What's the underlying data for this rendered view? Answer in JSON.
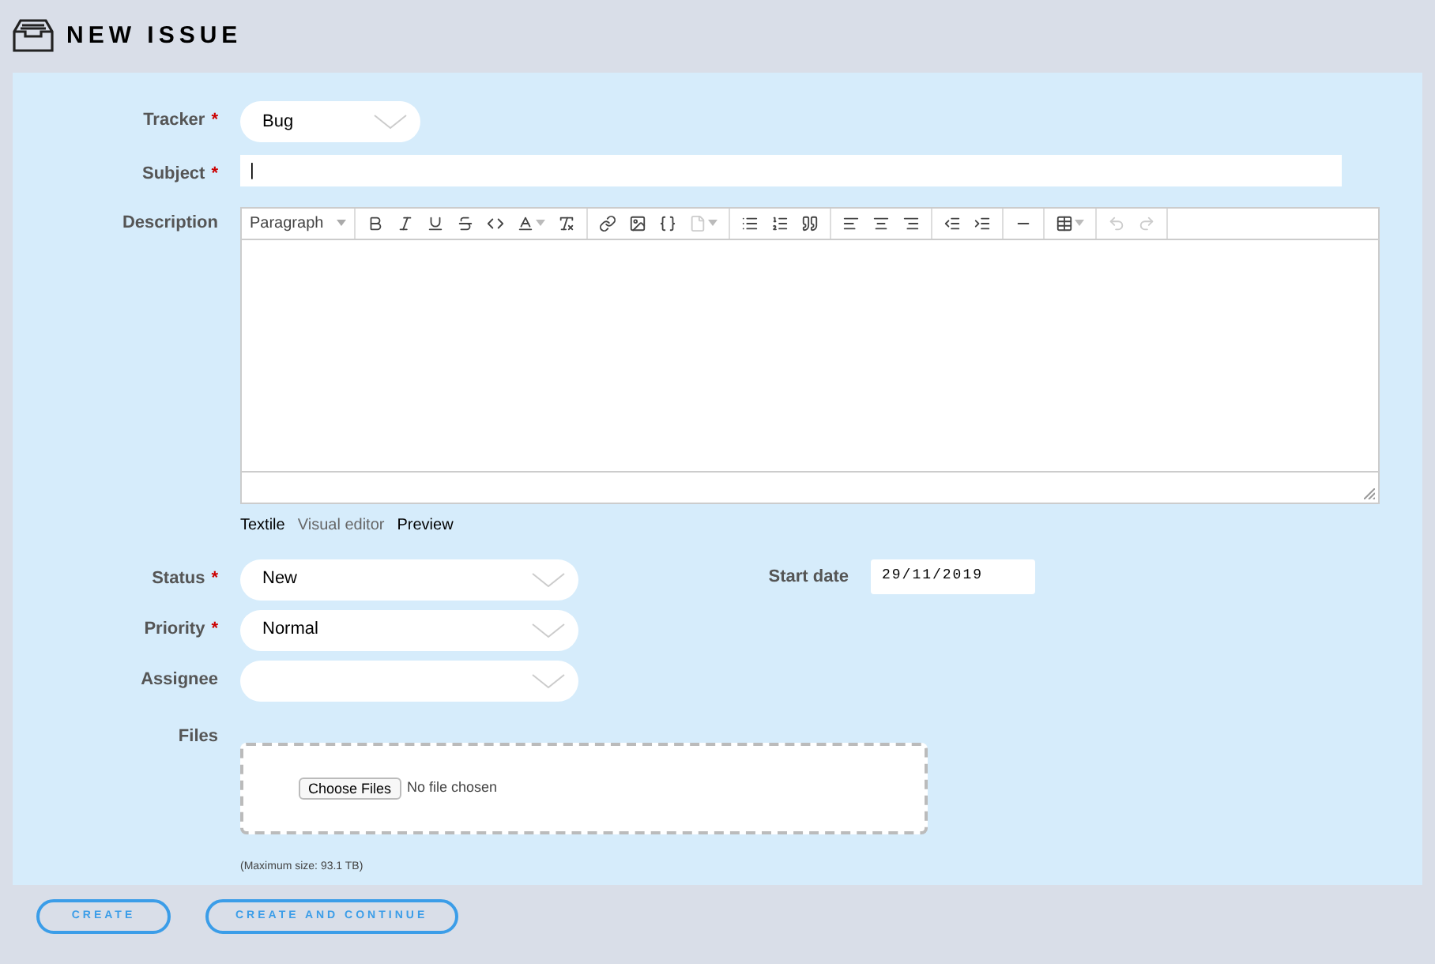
{
  "header": {
    "title": "NEW ISSUE"
  },
  "fields": [
    {
      "kind": "select",
      "label": "Tracker",
      "required_mark": "*",
      "value": "Bug"
    },
    {
      "kind": "text",
      "label": "Subject",
      "required_mark": "*",
      "value": "|"
    }
  ],
  "description": {
    "label": "Description",
    "paragraph": "Paragraph",
    "toolbar": [
      [
        {
          "kind": "bold",
          "disabled": false
        },
        {
          "kind": "italic",
          "disabled": false
        },
        {
          "kind": "underline",
          "disabled": false
        },
        {
          "kind": "strike",
          "disabled": false
        },
        {
          "kind": "code",
          "disabled": false
        },
        {
          "kind": "color",
          "disabled": false
        },
        {
          "kind": "clear",
          "disabled": false
        }
      ],
      [
        {
          "kind": "link",
          "disabled": false
        },
        {
          "kind": "image",
          "disabled": false
        },
        {
          "kind": "codeblock",
          "disabled": false
        },
        {
          "kind": "file",
          "disabled": true
        }
      ],
      [
        {
          "kind": "bullets",
          "disabled": false
        },
        {
          "kind": "numbers",
          "disabled": false
        },
        {
          "kind": "quote",
          "disabled": false
        }
      ],
      [
        {
          "kind": "left",
          "disabled": false
        },
        {
          "kind": "center",
          "disabled": false
        },
        {
          "kind": "right",
          "disabled": false
        }
      ],
      [
        {
          "kind": "outdent",
          "disabled": false
        },
        {
          "kind": "indent",
          "disabled": false
        }
      ],
      [
        {
          "kind": "rule",
          "disabled": false
        }
      ],
      [
        {
          "kind": "table",
          "disabled": false
        }
      ],
      [
        {
          "kind": "undo",
          "disabled": true
        },
        {
          "kind": "redo",
          "disabled": true
        }
      ]
    ],
    "tabs": [
      {
        "label": "Textile",
        "dimmed": false
      },
      {
        "label": "Visual editor",
        "dimmed": true
      },
      {
        "label": "Preview",
        "dimmed": false
      }
    ]
  },
  "left_fields": [
    {
      "label": "Status",
      "required_mark": "*",
      "value": "New"
    },
    {
      "label": "Priority",
      "required_mark": "*",
      "value": "Normal"
    },
    {
      "label": "Assignee"
    }
  ],
  "start_date": {
    "label": "Start date",
    "value": "29/11/2019"
  },
  "files": {
    "label": "Files",
    "button": "Choose Files",
    "status": "No file chosen",
    "note": "(Maximum size: 93.1 TB)"
  },
  "buttons": [
    "CREATE",
    "CREATE AND CONTINUE"
  ]
}
